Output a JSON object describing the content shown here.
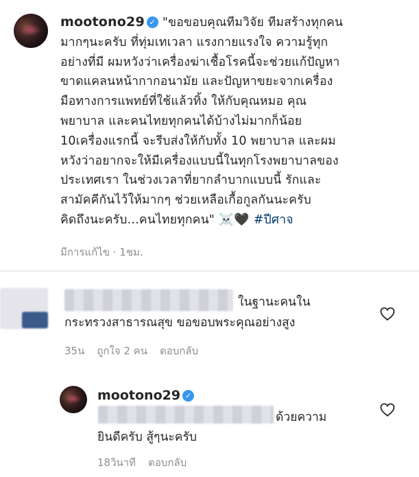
{
  "post": {
    "username": "mootono29",
    "caption": "\"ขอขอบคุณทีมวิจัย ทีมสร้างทุกคน\nมากๆนะครับ ที่ทุ่มเทเวลา แรงกายแรงใจ ความรู้ทุก\nอย่างที่มี ผมหวังว่าเครื่องฆ่าเชื้อโรคนี้จะช่วยแก้ปัญหา\nขาดแคลนหน้ากากอนามัย และปัญหาขยะจากเครื่อง\nมือทางการแพทย์ที่ใช้แล้วทิ้ง ให้กับคุณหมอ คุณ\nพยาบาล และคนไทยทุกคนได้บ้างไม่มากก็น้อย\n10เครื่องแรกนี้ จะรีบส่งให้กับทั้ง 10 พยาบาล และผม\nหวังว่าอยากจะให้มีเครื่องแบบนี้ในทุกโรงพยาบาลของ\nประเทศเรา ในช่วงเวลาที่ยากลำบากแบบนี้ รักและ\nสามัคคีกันไว้ให้มากๆ ช่วยเหลือเกื้อกูลกันนะครับ\nคิดถึงนะครับ...คนไทยทุกคน\"",
    "emojis": "☠️🖤",
    "hashtag": "#ปีศาจ",
    "edited_label": "มีการแก้ไข · 1ชม."
  },
  "comment1": {
    "text_line1": "ในฐานะคนใน",
    "text_line2": "กระทรวงสาธารณสุข ขอขอบพระคุณอย่างสูง",
    "time": "35น",
    "likes": "ถูกใจ 2 คน",
    "reply_label": "ตอบกลับ"
  },
  "comment2": {
    "username": "mootono29",
    "text_line1": "ด้วยความ",
    "text_line2": "ยินดีครับ สู้ๆนะครับ",
    "time": "18วินาที",
    "reply_label": "ตอบกลับ"
  },
  "icons": {
    "verified": "verified-badge-icon",
    "like": "heart-outline-icon"
  }
}
